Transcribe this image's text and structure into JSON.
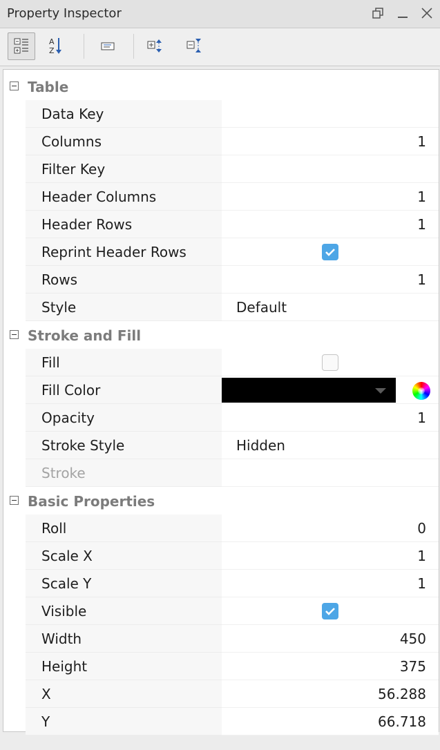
{
  "window": {
    "title": "Property Inspector",
    "controls": [
      "restore-icon",
      "minimize-icon",
      "close-icon"
    ]
  },
  "toolbar": {
    "buttons": [
      {
        "name": "categorized-view-button",
        "icon": "categorized-icon",
        "active": true
      },
      {
        "name": "alphabetical-sort-button",
        "icon": "sort-az-icon",
        "active": false
      },
      {
        "name": "description-toggle-button",
        "icon": "description-panel-icon",
        "active": false
      },
      {
        "name": "expand-all-button",
        "icon": "expand-all-icon",
        "active": false
      },
      {
        "name": "collapse-all-button",
        "icon": "collapse-all-icon",
        "active": false
      }
    ]
  },
  "colors": {
    "checkbox_checked": "#4da6e6",
    "fill_color_value": "#000000",
    "category_text": "#7c7c7c",
    "disabled_text": "#a3a3a3"
  },
  "categories": [
    {
      "label": "Table",
      "properties": [
        {
          "name": "Data Key",
          "value": ""
        },
        {
          "name": "Columns",
          "value": "1"
        },
        {
          "name": "Filter Key",
          "value": ""
        },
        {
          "name": "Header Columns",
          "value": "1"
        },
        {
          "name": "Header Rows",
          "value": "1"
        },
        {
          "name": "Reprint Header Rows",
          "checked": true
        },
        {
          "name": "Rows",
          "value": "1"
        },
        {
          "name": "Style",
          "value": "Default"
        }
      ]
    },
    {
      "label": "Stroke and Fill",
      "properties": [
        {
          "name": "Fill",
          "checked": false
        },
        {
          "name": "Fill Color",
          "value": "#000000"
        },
        {
          "name": "Opacity",
          "value": "1"
        },
        {
          "name": "Stroke Style",
          "value": "Hidden"
        },
        {
          "name": "Stroke",
          "disabled": true
        }
      ]
    },
    {
      "label": "Basic Properties",
      "properties": [
        {
          "name": "Roll",
          "value": "0"
        },
        {
          "name": "Scale X",
          "value": "1"
        },
        {
          "name": "Scale Y",
          "value": "1"
        },
        {
          "name": "Visible",
          "checked": true
        },
        {
          "name": "Width",
          "value": "450"
        },
        {
          "name": "Height",
          "value": "375"
        },
        {
          "name": "X",
          "value": "56.288"
        },
        {
          "name": "Y",
          "value": "66.718"
        }
      ]
    }
  ]
}
